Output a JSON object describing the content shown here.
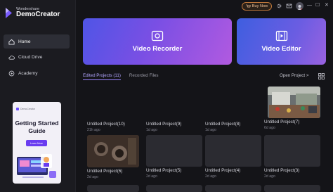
{
  "app": {
    "brand_sub": "Wondershare",
    "brand_name": "DemoCreator"
  },
  "topbar": {
    "buy_now": "Buy Now",
    "icons": [
      "gear-icon",
      "mail-icon",
      "user-avatar"
    ],
    "window_controls": [
      "—",
      "☐",
      "✕"
    ]
  },
  "sidebar": {
    "items": [
      {
        "label": "Home",
        "icon": "home-icon",
        "active": true
      },
      {
        "label": "Cloud Drive",
        "icon": "cloud-icon",
        "active": false
      },
      {
        "label": "Academy",
        "icon": "academy-icon",
        "active": false
      }
    ]
  },
  "promo": {
    "brand": "DemoCreator",
    "title": "Getting Started Guide",
    "cta": "Learn More"
  },
  "hero": {
    "recorder": "Video Recorder",
    "editor": "Video Editor"
  },
  "tabs": {
    "edited": "Edited Projects (11)",
    "recorded": "Recorded Files"
  },
  "open_project": "Open Project >",
  "projects": [
    {
      "title": "Untitled Project(10)",
      "time": "21h ago"
    },
    {
      "title": "Untitled Project(9)",
      "time": "1d ago"
    },
    {
      "title": "Untitled Project(8)",
      "time": "1d ago"
    },
    {
      "title": "Untitled Project(7)",
      "time": "6d ago"
    },
    {
      "title": "Untitled Project(6)",
      "time": "2d ago"
    },
    {
      "title": "Untitled Project(5)",
      "time": "2d ago"
    },
    {
      "title": "Untitled Project(4)",
      "time": "2d ago"
    },
    {
      "title": "Untitled Project(3)",
      "time": "2d ago"
    }
  ],
  "colors": {
    "accent": "#9b86ff",
    "buy_now": "#c2793b",
    "background": "#141418"
  }
}
